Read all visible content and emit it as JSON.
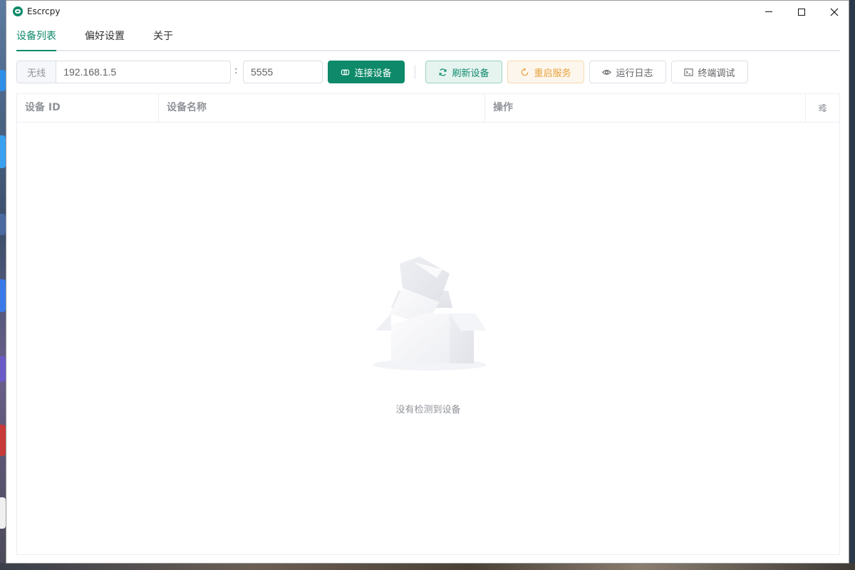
{
  "window": {
    "title": "Escrcpy"
  },
  "tabs": [
    {
      "label": "设备列表",
      "active": true
    },
    {
      "label": "偏好设置",
      "active": false
    },
    {
      "label": "关于",
      "active": false
    }
  ],
  "toolbar": {
    "prefix_label": "无线",
    "host_value": "192.168.1.5",
    "colon": ":",
    "port_value": "5555",
    "connect_label": "连接设备",
    "refresh_label": "刷新设备",
    "restart_label": "重启服务",
    "log_label": "运行日志",
    "terminal_label": "终端调试"
  },
  "table": {
    "columns": [
      "设备 ID",
      "设备名称",
      "操作"
    ],
    "settings_icon": "sliders-icon",
    "empty_text": "没有检测到设备"
  },
  "colors": {
    "primary": "#0e8a6a",
    "warning": "#e6a23c"
  }
}
